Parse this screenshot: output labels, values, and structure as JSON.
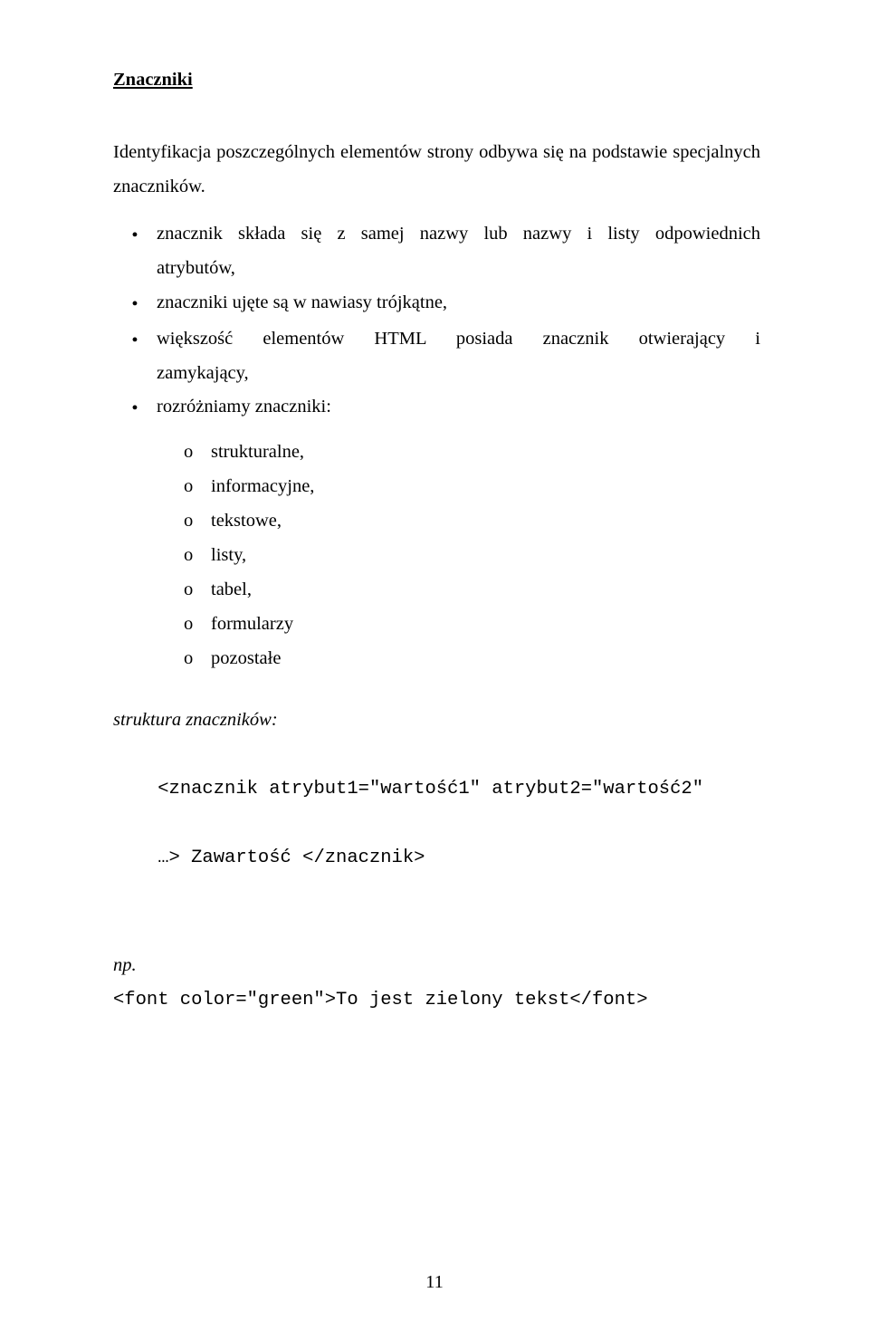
{
  "heading": "Znaczniki",
  "intro": "Identyfikacja poszczególnych elementów strony odbywa się na podstawie specjalnych znaczników.",
  "bullet_marker": "•",
  "bullets": [
    "znacznik składa się z samej nazwy lub nazwy i listy odpowiednich atrybutów,",
    "znaczniki ujęte są w nawiasy trójkątne,",
    "większość elementów HTML posiada znacznik otwierający i zamykający,",
    "rozróżniamy znaczniki:"
  ],
  "sub_marker": "o",
  "subitems": [
    "strukturalne,",
    " informacyjne,",
    " tekstowe,",
    "listy,",
    "tabel,",
    "formularzy",
    "pozostałe"
  ],
  "struct_label": "struktura znaczników:",
  "code_line1": "<znacznik atrybut1=\"wartość1\" atrybut2=\"wartość2\"",
  "code_line2": "…> Zawartość </znacznik>",
  "np_label": "np.",
  "example_code": "<font color=\"green\">To jest zielony tekst</font>",
  "page_number": "11"
}
